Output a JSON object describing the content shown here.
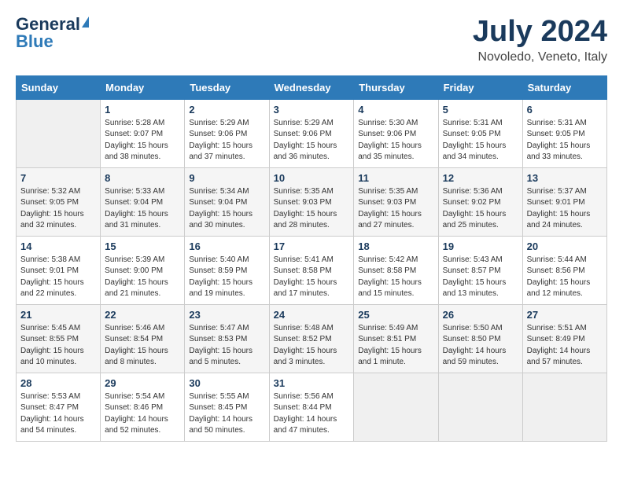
{
  "header": {
    "logo_general": "General",
    "logo_blue": "Blue",
    "title": "July 2024",
    "location": "Novoledo, Veneto, Italy"
  },
  "weekdays": [
    "Sunday",
    "Monday",
    "Tuesday",
    "Wednesday",
    "Thursday",
    "Friday",
    "Saturday"
  ],
  "weeks": [
    [
      {
        "day": "",
        "info": ""
      },
      {
        "day": "1",
        "info": "Sunrise: 5:28 AM\nSunset: 9:07 PM\nDaylight: 15 hours\nand 38 minutes."
      },
      {
        "day": "2",
        "info": "Sunrise: 5:29 AM\nSunset: 9:06 PM\nDaylight: 15 hours\nand 37 minutes."
      },
      {
        "day": "3",
        "info": "Sunrise: 5:29 AM\nSunset: 9:06 PM\nDaylight: 15 hours\nand 36 minutes."
      },
      {
        "day": "4",
        "info": "Sunrise: 5:30 AM\nSunset: 9:06 PM\nDaylight: 15 hours\nand 35 minutes."
      },
      {
        "day": "5",
        "info": "Sunrise: 5:31 AM\nSunset: 9:05 PM\nDaylight: 15 hours\nand 34 minutes."
      },
      {
        "day": "6",
        "info": "Sunrise: 5:31 AM\nSunset: 9:05 PM\nDaylight: 15 hours\nand 33 minutes."
      }
    ],
    [
      {
        "day": "7",
        "info": "Sunrise: 5:32 AM\nSunset: 9:05 PM\nDaylight: 15 hours\nand 32 minutes."
      },
      {
        "day": "8",
        "info": "Sunrise: 5:33 AM\nSunset: 9:04 PM\nDaylight: 15 hours\nand 31 minutes."
      },
      {
        "day": "9",
        "info": "Sunrise: 5:34 AM\nSunset: 9:04 PM\nDaylight: 15 hours\nand 30 minutes."
      },
      {
        "day": "10",
        "info": "Sunrise: 5:35 AM\nSunset: 9:03 PM\nDaylight: 15 hours\nand 28 minutes."
      },
      {
        "day": "11",
        "info": "Sunrise: 5:35 AM\nSunset: 9:03 PM\nDaylight: 15 hours\nand 27 minutes."
      },
      {
        "day": "12",
        "info": "Sunrise: 5:36 AM\nSunset: 9:02 PM\nDaylight: 15 hours\nand 25 minutes."
      },
      {
        "day": "13",
        "info": "Sunrise: 5:37 AM\nSunset: 9:01 PM\nDaylight: 15 hours\nand 24 minutes."
      }
    ],
    [
      {
        "day": "14",
        "info": "Sunrise: 5:38 AM\nSunset: 9:01 PM\nDaylight: 15 hours\nand 22 minutes."
      },
      {
        "day": "15",
        "info": "Sunrise: 5:39 AM\nSunset: 9:00 PM\nDaylight: 15 hours\nand 21 minutes."
      },
      {
        "day": "16",
        "info": "Sunrise: 5:40 AM\nSunset: 8:59 PM\nDaylight: 15 hours\nand 19 minutes."
      },
      {
        "day": "17",
        "info": "Sunrise: 5:41 AM\nSunset: 8:58 PM\nDaylight: 15 hours\nand 17 minutes."
      },
      {
        "day": "18",
        "info": "Sunrise: 5:42 AM\nSunset: 8:58 PM\nDaylight: 15 hours\nand 15 minutes."
      },
      {
        "day": "19",
        "info": "Sunrise: 5:43 AM\nSunset: 8:57 PM\nDaylight: 15 hours\nand 13 minutes."
      },
      {
        "day": "20",
        "info": "Sunrise: 5:44 AM\nSunset: 8:56 PM\nDaylight: 15 hours\nand 12 minutes."
      }
    ],
    [
      {
        "day": "21",
        "info": "Sunrise: 5:45 AM\nSunset: 8:55 PM\nDaylight: 15 hours\nand 10 minutes."
      },
      {
        "day": "22",
        "info": "Sunrise: 5:46 AM\nSunset: 8:54 PM\nDaylight: 15 hours\nand 8 minutes."
      },
      {
        "day": "23",
        "info": "Sunrise: 5:47 AM\nSunset: 8:53 PM\nDaylight: 15 hours\nand 5 minutes."
      },
      {
        "day": "24",
        "info": "Sunrise: 5:48 AM\nSunset: 8:52 PM\nDaylight: 15 hours\nand 3 minutes."
      },
      {
        "day": "25",
        "info": "Sunrise: 5:49 AM\nSunset: 8:51 PM\nDaylight: 15 hours\nand 1 minute."
      },
      {
        "day": "26",
        "info": "Sunrise: 5:50 AM\nSunset: 8:50 PM\nDaylight: 14 hours\nand 59 minutes."
      },
      {
        "day": "27",
        "info": "Sunrise: 5:51 AM\nSunset: 8:49 PM\nDaylight: 14 hours\nand 57 minutes."
      }
    ],
    [
      {
        "day": "28",
        "info": "Sunrise: 5:53 AM\nSunset: 8:47 PM\nDaylight: 14 hours\nand 54 minutes."
      },
      {
        "day": "29",
        "info": "Sunrise: 5:54 AM\nSunset: 8:46 PM\nDaylight: 14 hours\nand 52 minutes."
      },
      {
        "day": "30",
        "info": "Sunrise: 5:55 AM\nSunset: 8:45 PM\nDaylight: 14 hours\nand 50 minutes."
      },
      {
        "day": "31",
        "info": "Sunrise: 5:56 AM\nSunset: 8:44 PM\nDaylight: 14 hours\nand 47 minutes."
      },
      {
        "day": "",
        "info": ""
      },
      {
        "day": "",
        "info": ""
      },
      {
        "day": "",
        "info": ""
      }
    ]
  ]
}
